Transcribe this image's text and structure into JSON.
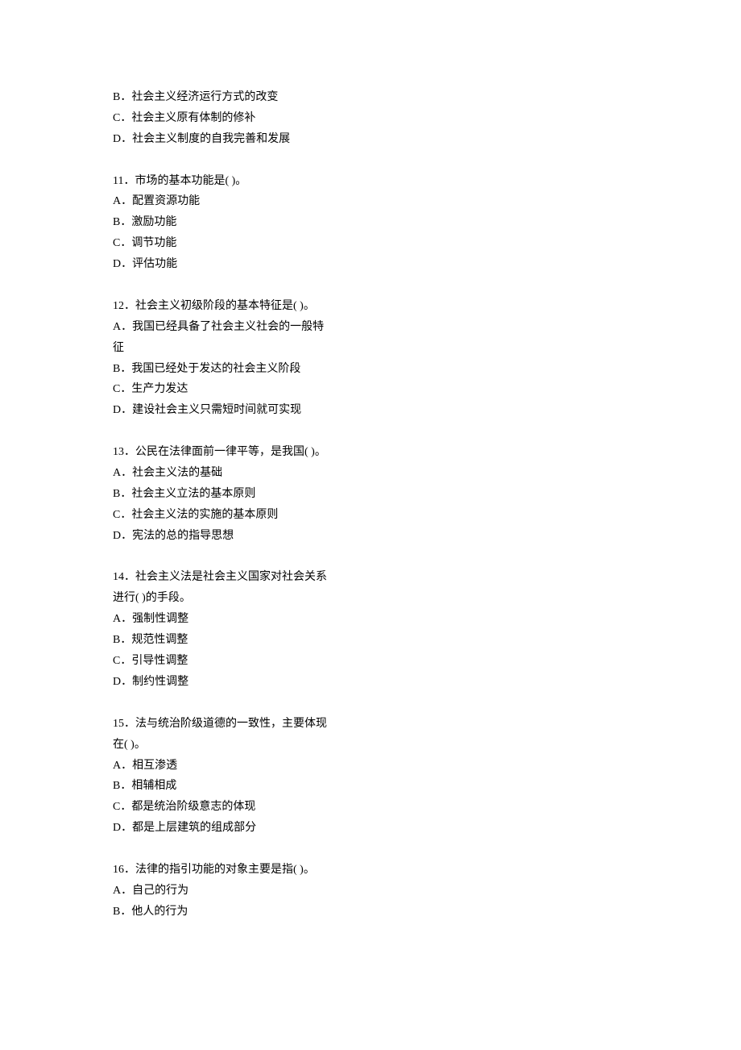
{
  "lines": [
    "B．社会主义经济运行方式的改变",
    "C．社会主义原有体制的修补",
    "D．社会主义制度的自我完善和发展",
    "",
    "11．市场的基本功能是(  )。",
    "A．配置资源功能",
    "B．激励功能",
    "C．调节功能",
    "D．评估功能",
    "",
    "12．社会主义初级阶段的基本特征是(  )。",
    "A．我国已经具备了社会主义社会的一般特征",
    "B．我国已经处于发达的社会主义阶段",
    "C．生产力发达",
    "D．建设社会主义只需短时间就可实现",
    "",
    "13．公民在法律面前一律平等，是我国(  )。",
    "A．社会主义法的基础",
    "B．社会主义立法的基本原则",
    "C．社会主义法的实施的基本原则",
    "D．宪法的总的指导思想",
    "",
    "14．社会主义法是社会主义国家对社会关系进行(  )的手段。",
    "A．强制性调整",
    "B．规范性调整",
    "C．引导性调整",
    "D．制约性调整",
    "",
    "15．法与统治阶级道德的一致性，主要体现在(  )。",
    "A．相互渗透",
    "B．相辅相成",
    "C．都是统治阶级意志的体现",
    "D．都是上层建筑的组成部分",
    "",
    "16．法律的指引功能的对象主要是指(  )。",
    "A．自己的行为",
    "B．他人的行为"
  ]
}
